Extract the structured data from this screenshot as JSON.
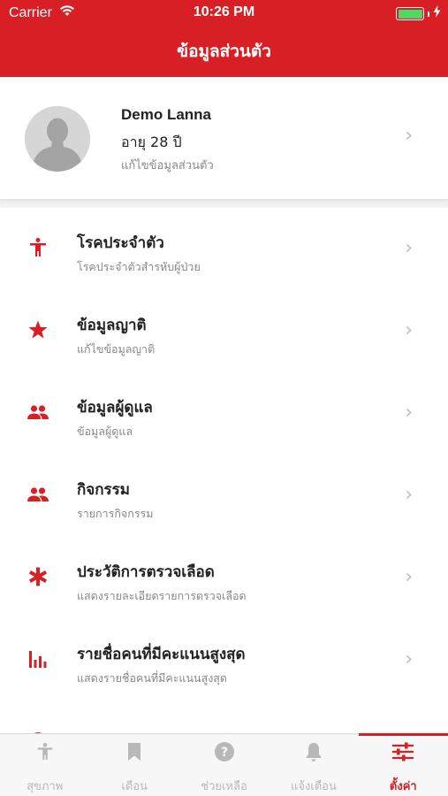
{
  "status_bar": {
    "carrier": "Carrier",
    "time": "10:26 PM"
  },
  "nav": {
    "title": "ข้อมูลส่วนตัว"
  },
  "profile": {
    "name": "Demo Lanna",
    "age": "อายุ 28 ปี",
    "edit_label": "แก้ไขข้อมูลส่วนตัว"
  },
  "menu": [
    {
      "title": "โรคประจำตัว",
      "subtitle": "โรคประจำตัวสำรหับผู้ป่วย",
      "icon": "accessibility-icon"
    },
    {
      "title": "ข้อมูลญาติ",
      "subtitle": "แก้ไขข้อมูลญาติ",
      "icon": "star-icon"
    },
    {
      "title": "ข้อมูลผู้ดูแล",
      "subtitle": "ข้อมูลผู้ดูแล",
      "icon": "people-icon"
    },
    {
      "title": "กิจกรรม",
      "subtitle": "รายการกิจกรรม",
      "icon": "people-icon"
    },
    {
      "title": "ประวัติการตรวจเลือด",
      "subtitle": "แสดงรายละเอียดรายการตรวจเลือด",
      "icon": "asterisk-icon"
    },
    {
      "title": "รายชื่อคนที่มีคะแนนสูงสุด",
      "subtitle": "แสดงรายชื่อคนที่มีคะแนนสูงสุด",
      "icon": "bar-chart-icon"
    }
  ],
  "tabs": [
    {
      "label": "สุขภาพ",
      "icon": "accessibility-icon"
    },
    {
      "label": "เตือน",
      "icon": "bookmark-icon"
    },
    {
      "label": "ช่วยเหลือ",
      "icon": "help-icon"
    },
    {
      "label": "แจ้งเตือน",
      "icon": "bell-icon"
    },
    {
      "label": "ตั้งค่า",
      "icon": "sliders-icon",
      "active": true
    }
  ],
  "colors": {
    "brand": "#d91f26",
    "battery": "#4cd964",
    "inactive": "#b8b8b8",
    "subtitle": "#888888"
  }
}
